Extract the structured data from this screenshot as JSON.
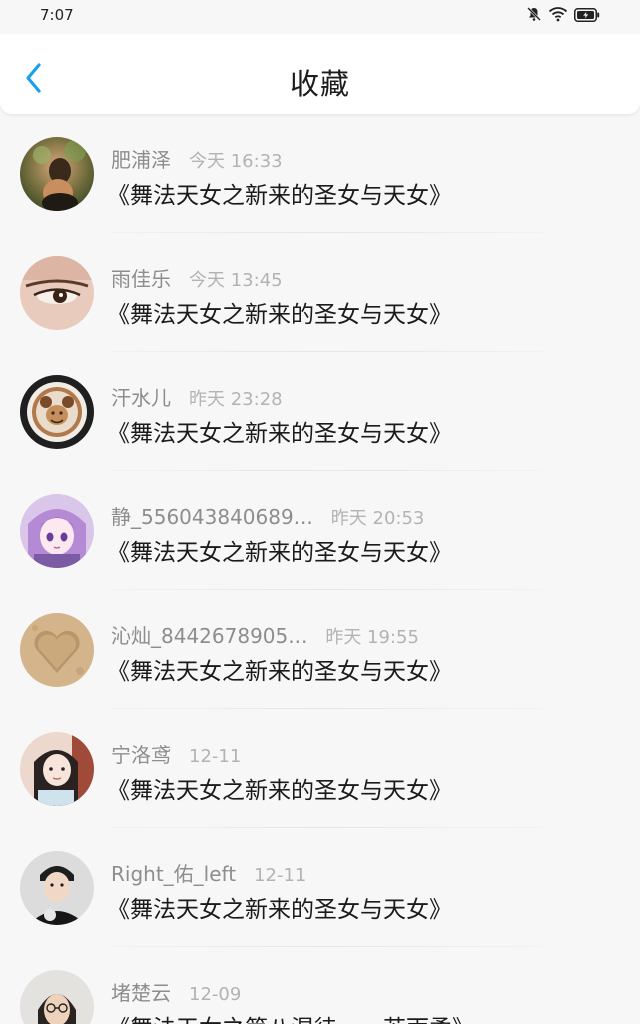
{
  "status_bar": {
    "time": "7:07",
    "icons": [
      "mute-icon",
      "wifi-icon",
      "battery-icon"
    ]
  },
  "header": {
    "title": "收藏",
    "back_icon": "chevron-left-icon",
    "accent_color": "#1aa0ec"
  },
  "items": [
    {
      "username": "肥浦泽",
      "time": "今天 16:33",
      "title": "《舞法天女之新来的圣女与天女》"
    },
    {
      "username": "雨佳乐",
      "time": "今天 13:45",
      "title": "《舞法天女之新来的圣女与天女》"
    },
    {
      "username": "汗水儿",
      "time": "昨天 23:28",
      "title": "《舞法天女之新来的圣女与天女》"
    },
    {
      "username": "静_556043840689...",
      "time": "昨天 20:53",
      "title": "《舞法天女之新来的圣女与天女》"
    },
    {
      "username": "沁灿_8442678905...",
      "time": "昨天 19:55",
      "title": "《舞法天女之新来的圣女与天女》"
    },
    {
      "username": "宁洛鸢",
      "time": "12-11",
      "title": "《舞法天女之新来的圣女与天女》"
    },
    {
      "username": "Right_佑_left",
      "time": "12-11",
      "title": "《舞法天女之新来的圣女与天女》"
    },
    {
      "username": "堵楚云",
      "time": "12-09",
      "title": "《舞法天女之第八混徒——苏雨柔》"
    }
  ]
}
